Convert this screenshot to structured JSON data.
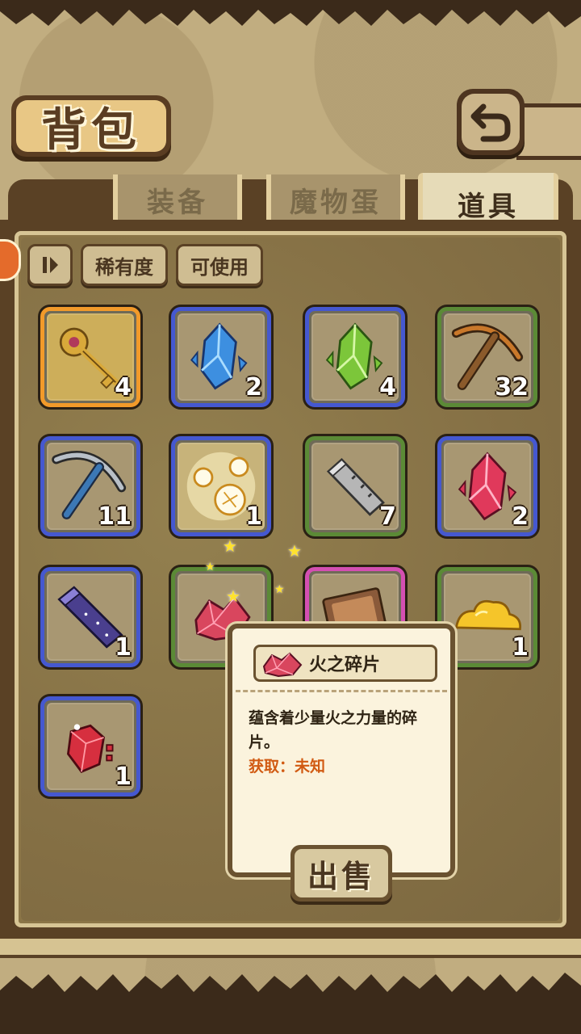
{
  "header": {
    "title": "背包",
    "back_icon": "back-arrow-icon"
  },
  "tabs": [
    {
      "label": "装备",
      "active": false
    },
    {
      "label": "魔物蛋",
      "active": false
    },
    {
      "label": "道具",
      "active": true
    }
  ],
  "filters": {
    "sort_icon": "sort-toggle-icon",
    "rarity_label": "稀有度",
    "usable_label": "可使用"
  },
  "items": [
    {
      "name": "golden-key",
      "count": "4",
      "frame": "orange"
    },
    {
      "name": "blue-crystal",
      "count": "2",
      "frame": "blue"
    },
    {
      "name": "green-crystal",
      "count": "4",
      "frame": "blue"
    },
    {
      "name": "wooden-pickaxe",
      "count": "32",
      "frame": "green"
    },
    {
      "name": "steel-pickaxe",
      "count": "11",
      "frame": "blue"
    },
    {
      "name": "light-orbs",
      "count": "1",
      "frame": "blue"
    },
    {
      "name": "iron-ingot",
      "count": "7",
      "frame": "green"
    },
    {
      "name": "red-crystal",
      "count": "2",
      "frame": "blue"
    },
    {
      "name": "starry-ingot",
      "count": "1",
      "frame": "blue"
    },
    {
      "name": "fire-shards",
      "count": "",
      "frame": "green"
    },
    {
      "name": "scroll-card",
      "count": "",
      "frame": "pink"
    },
    {
      "name": "gold-pile",
      "count": "1",
      "frame": "green"
    },
    {
      "name": "ruby-fragment",
      "count": "1",
      "frame": "blue"
    }
  ],
  "tooltip": {
    "name": "火之碎片",
    "description": "蕴含着少量火之力量的碎片。",
    "source_label": "获取：未知",
    "sell_label": "出售"
  },
  "colors": {
    "rare_blue": "#4558d0",
    "common_green": "#5b8a36",
    "legendary_orange": "#f29a2a",
    "epic_pink": "#d44fb2",
    "source_orange": "#d15a12"
  }
}
